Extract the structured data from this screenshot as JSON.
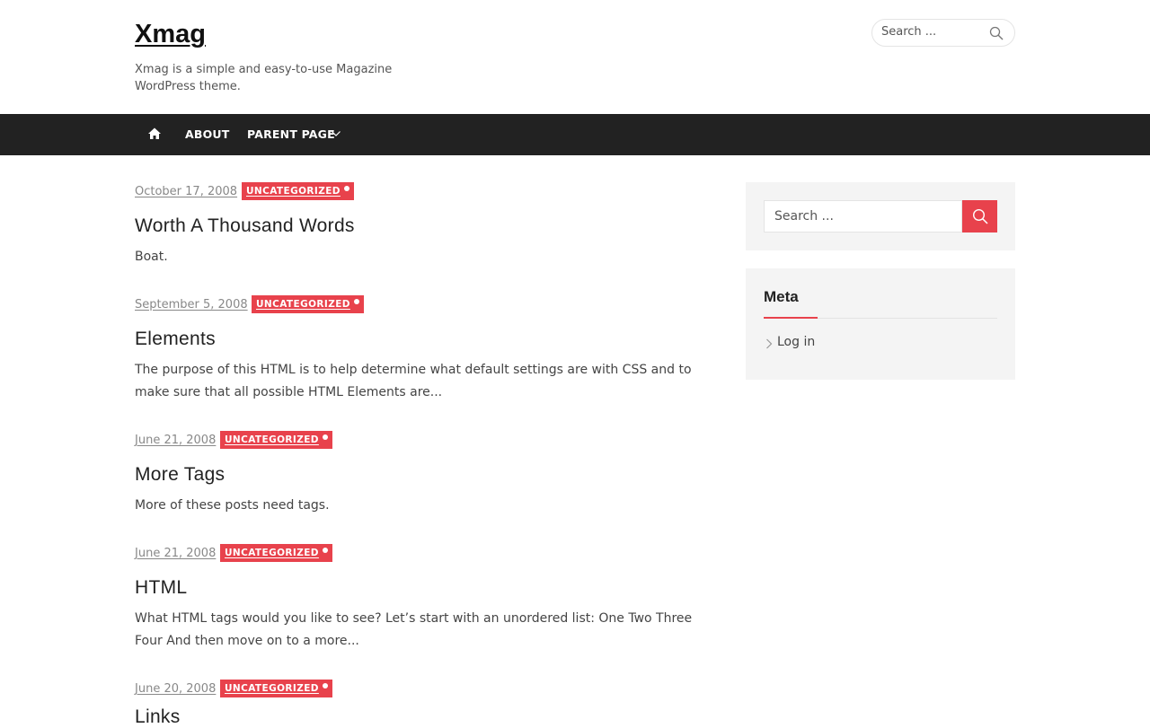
{
  "site": {
    "title": "Xmag",
    "description": "Xmag is a simple and easy-to-use Magazine WordPress theme."
  },
  "header_search": {
    "placeholder": "Search ..."
  },
  "nav": {
    "home_icon": "home-icon",
    "items": [
      {
        "label": "ABOUT"
      },
      {
        "label": "PARENT PAGE",
        "has_submenu": true
      }
    ]
  },
  "posts": [
    {
      "date": "October 17, 2008",
      "category": "UNCATEGORIZED",
      "title": "Worth A Thousand Words",
      "excerpt": "Boat."
    },
    {
      "date": "September 5, 2008",
      "category": "UNCATEGORIZED",
      "title": "Elements",
      "excerpt": "The purpose of this HTML is to help determine what default settings are with CSS and to make sure that all possible HTML Elements are..."
    },
    {
      "date": "June 21, 2008",
      "category": "UNCATEGORIZED",
      "title": "More Tags",
      "excerpt": "More of these posts need tags."
    },
    {
      "date": "June 21, 2008",
      "category": "UNCATEGORIZED",
      "title": "HTML",
      "excerpt": "What HTML tags would you like to see? Let’s start with an unordered list: One Two Three Four And then move on to a more..."
    },
    {
      "date": "June 20, 2008",
      "category": "UNCATEGORIZED",
      "title": "Links",
      "excerpt": ""
    }
  ],
  "sidebar": {
    "search": {
      "placeholder": "Search ..."
    },
    "meta": {
      "title": "Meta",
      "links": [
        {
          "label": "Log in"
        }
      ]
    }
  },
  "colors": {
    "accent": "#e8424c",
    "nav_bg": "#222222",
    "widget_bg": "#f4f4f4"
  }
}
